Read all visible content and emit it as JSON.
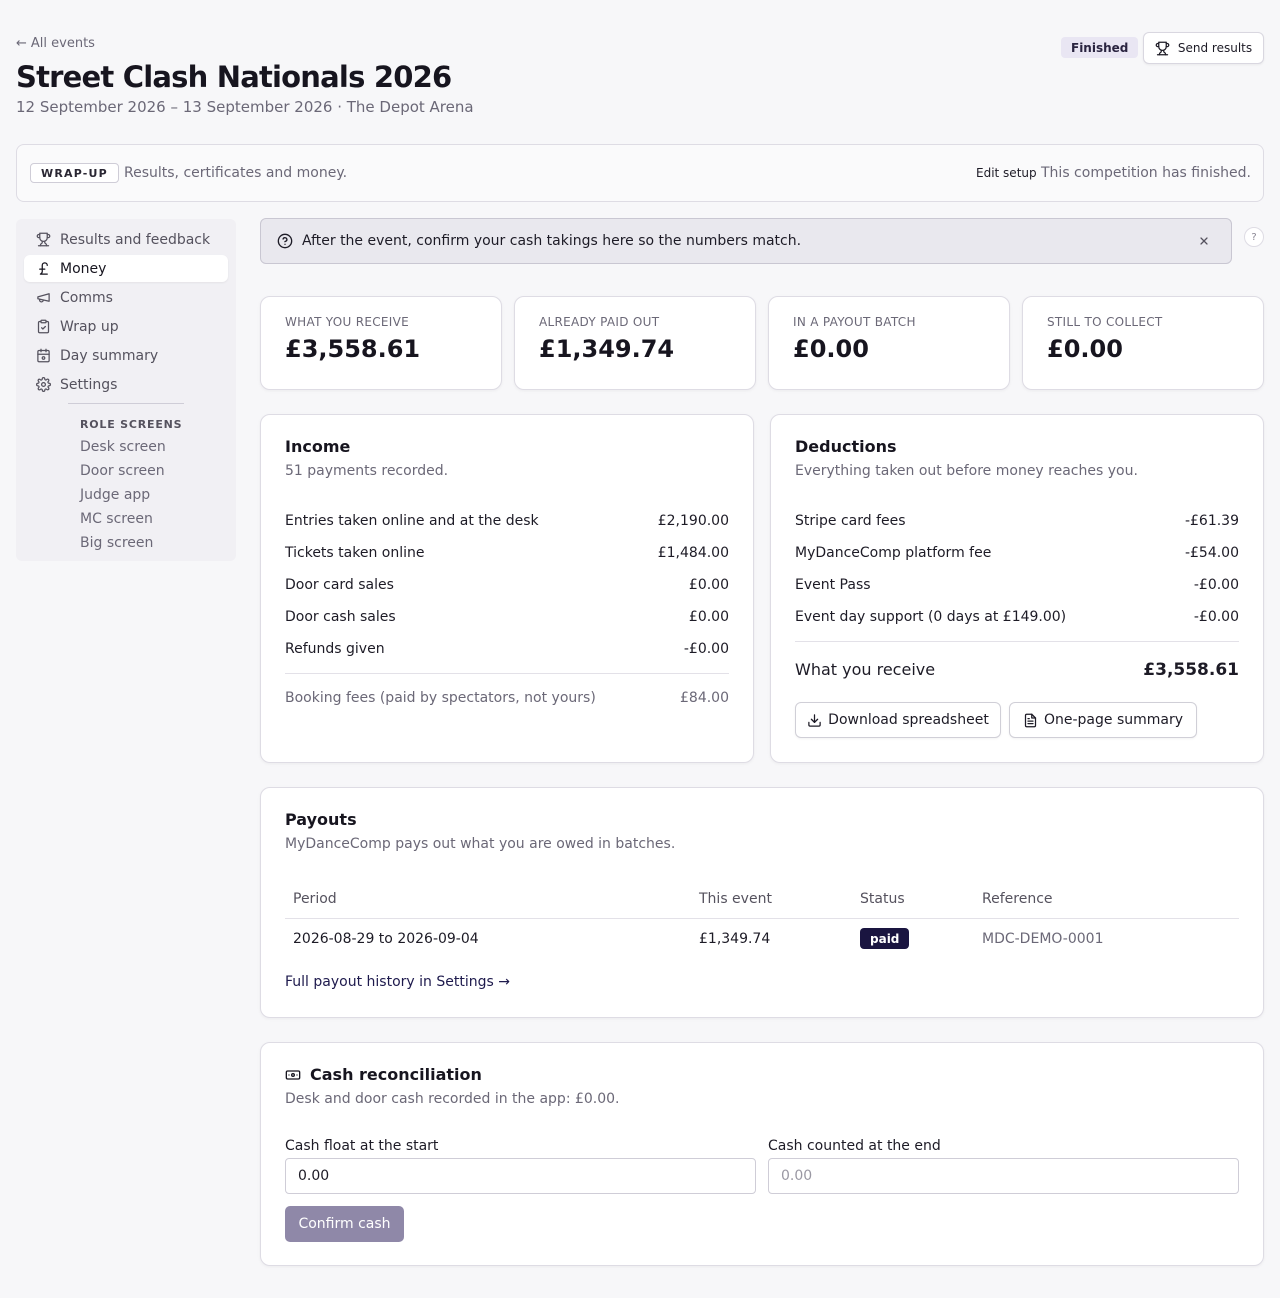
{
  "header": {
    "back_label": "All events",
    "title": "Street Clash Nationals 2026",
    "subtitle": "12 September 2026 – 13 September 2026 · The Depot Arena",
    "status": "Finished",
    "send_results_label": "Send results"
  },
  "phase": {
    "tag": "WRAP-UP",
    "description": "Results, certificates and money.",
    "edit_setup_label": "Edit setup",
    "note": "This competition has finished."
  },
  "sidebar": {
    "items": [
      {
        "label": "Results and feedback",
        "icon": "trophy-icon"
      },
      {
        "label": "Money",
        "icon": "pound-icon",
        "active": true
      },
      {
        "label": "Comms",
        "icon": "megaphone-icon"
      },
      {
        "label": "Wrap up",
        "icon": "clipboard-check-icon"
      },
      {
        "label": "Day summary",
        "icon": "calendar-icon"
      },
      {
        "label": "Settings",
        "icon": "gear-icon"
      }
    ],
    "role_heading": "ROLE SCREENS",
    "role_items": [
      "Desk screen",
      "Door screen",
      "Judge app",
      "MC screen",
      "Big screen"
    ]
  },
  "alert": {
    "text": "After the event, confirm your cash takings here so the numbers match.",
    "help": "?"
  },
  "stats": [
    {
      "label": "WHAT YOU RECEIVE",
      "value": "£3,558.61"
    },
    {
      "label": "ALREADY PAID OUT",
      "value": "£1,349.74"
    },
    {
      "label": "IN A PAYOUT BATCH",
      "value": "£0.00"
    },
    {
      "label": "STILL TO COLLECT",
      "value": "£0.00"
    }
  ],
  "income": {
    "title": "Income",
    "subtitle": "51 payments recorded.",
    "rows": [
      {
        "label": "Entries taken online and at the desk",
        "amount": "£2,190.00"
      },
      {
        "label": "Tickets taken online",
        "amount": "£1,484.00"
      },
      {
        "label": "Door card sales",
        "amount": "£0.00"
      },
      {
        "label": "Door cash sales",
        "amount": "£0.00"
      },
      {
        "label": "Refunds given",
        "amount": "-£0.00"
      }
    ],
    "booking_fees": {
      "label": "Booking fees (paid by spectators, not yours)",
      "amount": "£84.00"
    }
  },
  "deductions": {
    "title": "Deductions",
    "subtitle": "Everything taken out before money reaches you.",
    "rows": [
      {
        "label": "Stripe card fees",
        "amount": "-£61.39"
      },
      {
        "label": "MyDanceComp platform fee",
        "amount": "-£54.00"
      },
      {
        "label": "Event Pass",
        "amount": "-£0.00"
      },
      {
        "label": "Event day support (0 days at £149.00)",
        "amount": "-£0.00"
      }
    ],
    "total": {
      "label": "What you receive",
      "amount": "£3,558.61"
    },
    "download_label": "Download spreadsheet",
    "summary_label": "One-page summary"
  },
  "payouts": {
    "title": "Payouts",
    "subtitle": "MyDanceComp pays out what you are owed in batches.",
    "columns": [
      "Period",
      "This event",
      "Status",
      "Reference"
    ],
    "rows": [
      {
        "period": "2026-08-29 to 2026-09-04",
        "amount": "£1,349.74",
        "status": "paid",
        "reference": "MDC-DEMO-0001"
      }
    ],
    "history_link": "Full payout history in Settings →"
  },
  "cash": {
    "title": "Cash reconciliation",
    "subtitle": "Desk and door cash recorded in the app: £0.00.",
    "float_label": "Cash float at the start",
    "float_value": "0.00",
    "counted_label": "Cash counted at the end",
    "counted_placeholder": "0.00",
    "confirm_label": "Confirm cash"
  },
  "colors": {
    "accent_dark": "#1a1540",
    "muted_button": "#8f88a8",
    "badge_bg": "#e9e6f3"
  }
}
